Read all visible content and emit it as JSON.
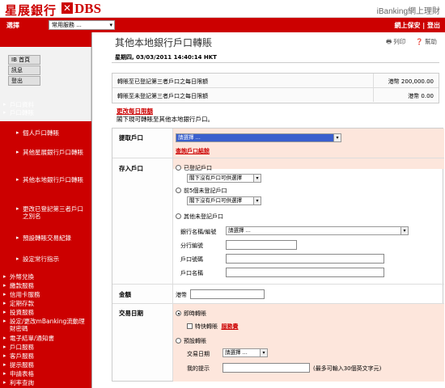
{
  "header": {
    "brand_cn": "星展銀行",
    "brand_x": "✕",
    "brand_dbs": "DBS",
    "brand_right": "iBanking網上理財"
  },
  "topnav": {
    "select_label": "選擇",
    "select_value": "常用服務 ...",
    "right_links": "網上保安 | 登出"
  },
  "sidebar": {
    "top_buttons": [
      "IB 首頁",
      "訊息",
      "登出"
    ],
    "main_items_a": [
      "戶口資料",
      "戶口轉賬"
    ],
    "sub_items": [
      "個人戶口轉賬",
      "其他星展銀行戶口轉賬",
      "其他本地銀行戶口轉賬",
      "更改已登記第三者戶口之別名",
      "預設轉賬交易紀錄",
      "設定常行指示"
    ],
    "main_items_b": [
      "外幣兌換",
      "繳款服務",
      "信用卡服務",
      "定期存款",
      "投資服務",
      "設定/更改mBanking流動理財密碼",
      "電子結單/通知書",
      "戶口服務",
      "客戶服務",
      "提示服務",
      "申請表格",
      "利率查詢"
    ]
  },
  "main": {
    "title": "其他本地銀行戶口轉賬",
    "print": "列印",
    "help": "幫助",
    "datetime": "星期四, 03/03/2011 14:40:14 HKT",
    "limits": [
      {
        "label": "轉賬至已登記第三者戶口之每日限額",
        "value": "港幣 200,000.00"
      },
      {
        "label": "轉賬至未登記第三者戶口之每日限額",
        "value": "港幣 0.00"
      }
    ],
    "change_limit": "更改每日限額",
    "note": "閣下現可轉賬至其他本地銀行戶口。",
    "from_label": "提取戶口",
    "from_select": "請選擇 ...",
    "balance_link": "查詢戶口結餘",
    "to_label": "存入戶口",
    "opt_registered": "已登記戶口",
    "opt_registered_select": "閣下沒有戶口可供選擇",
    "opt_recent": "前5個未登記戶口",
    "opt_recent_select": "閣下沒有戶口可供選擇",
    "opt_other": "其他未登記戶口",
    "bank_label": "銀行名稱/編號",
    "bank_select": "請選擇 ...",
    "branch_label": "分行編號",
    "acct_no_label": "戶口號碼",
    "acct_name_label": "戶口名稱",
    "amount_label": "金額",
    "currency": "港幣",
    "date_label": "交易日期",
    "immediate": "即時轉賬",
    "express": "特快轉賬",
    "fee_link": "服務費",
    "scheduled": "預設轉賬",
    "txn_date_label": "交易日期",
    "txn_date_select": "請選擇 ...",
    "reminder_label": "我的提示",
    "reminder_hint": "(最多可輸入30個英文字元)"
  }
}
